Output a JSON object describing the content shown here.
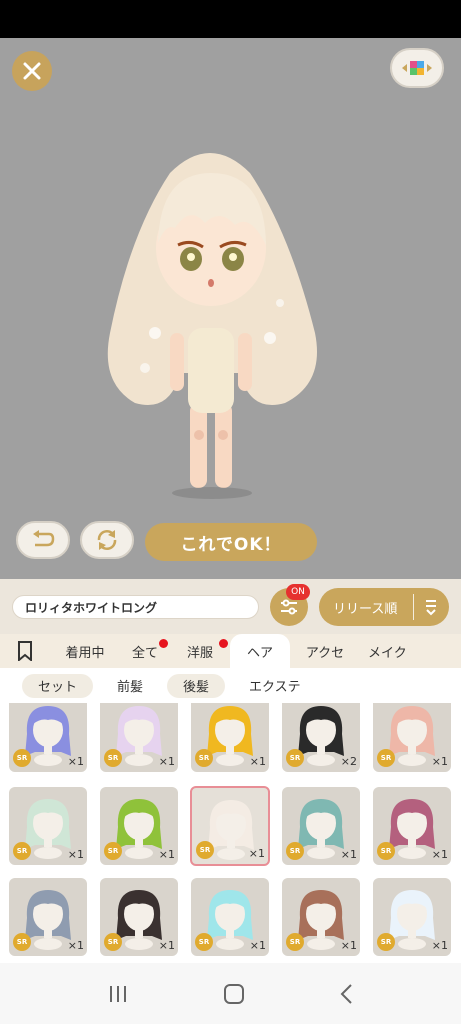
{
  "editor": {
    "ok_label": "これでOK！",
    "item_name": "ロリィタホワイトロング",
    "filter_badge": "ON",
    "sort_label": "リリース順"
  },
  "tabs": [
    {
      "label": "着用中"
    },
    {
      "label": "全て"
    },
    {
      "label": "洋服"
    },
    {
      "label": "ヘア"
    },
    {
      "label": "アクセ"
    },
    {
      "label": "メイク"
    }
  ],
  "subtabs": [
    {
      "label": "セット"
    },
    {
      "label": "前髪"
    },
    {
      "label": "後髪"
    },
    {
      "label": "エクステ"
    }
  ],
  "items": [
    {
      "rarity": "SR",
      "count": "×1",
      "hair": "#8a8fe0"
    },
    {
      "rarity": "SR",
      "count": "×1",
      "hair": "#e6d3ef"
    },
    {
      "rarity": "SR",
      "count": "×1",
      "hair": "#f0b820"
    },
    {
      "rarity": "SR",
      "count": "×2",
      "hair": "#2a2a2a"
    },
    {
      "rarity": "SR",
      "count": "×1",
      "hair": "#eeb7a8"
    },
    {
      "rarity": "SR",
      "count": "×1",
      "hair": "#cfe6d6"
    },
    {
      "rarity": "SR",
      "count": "×1",
      "hair": "#8fc23a"
    },
    {
      "rarity": "SR",
      "count": "×1",
      "hair": "#f4ece4"
    },
    {
      "rarity": "SR",
      "count": "×1",
      "hair": "#7fb8b2"
    },
    {
      "rarity": "SR",
      "count": "×1",
      "hair": "#b4607e"
    },
    {
      "rarity": "SR",
      "count": "×1",
      "hair": "#8f9cb0"
    },
    {
      "rarity": "SR",
      "count": "×1",
      "hair": "#3a3130"
    },
    {
      "rarity": "SR",
      "count": "×1",
      "hair": "#9fe6ea"
    },
    {
      "rarity": "SR",
      "count": "×1",
      "hair": "#a8705a"
    },
    {
      "rarity": "SR",
      "count": "×1",
      "hair": "#eaf3fb"
    }
  ],
  "colors": {
    "accent_gold": "#c9a65c",
    "badge_red": "#e6312f",
    "stage_gray": "#a0a0a0"
  },
  "icons": [
    "close-icon",
    "layout-icon",
    "undo-icon",
    "refresh-icon",
    "filter-sliders-icon",
    "sort-icon",
    "bookmark-icon",
    "recents-icon",
    "home-icon",
    "back-icon"
  ]
}
